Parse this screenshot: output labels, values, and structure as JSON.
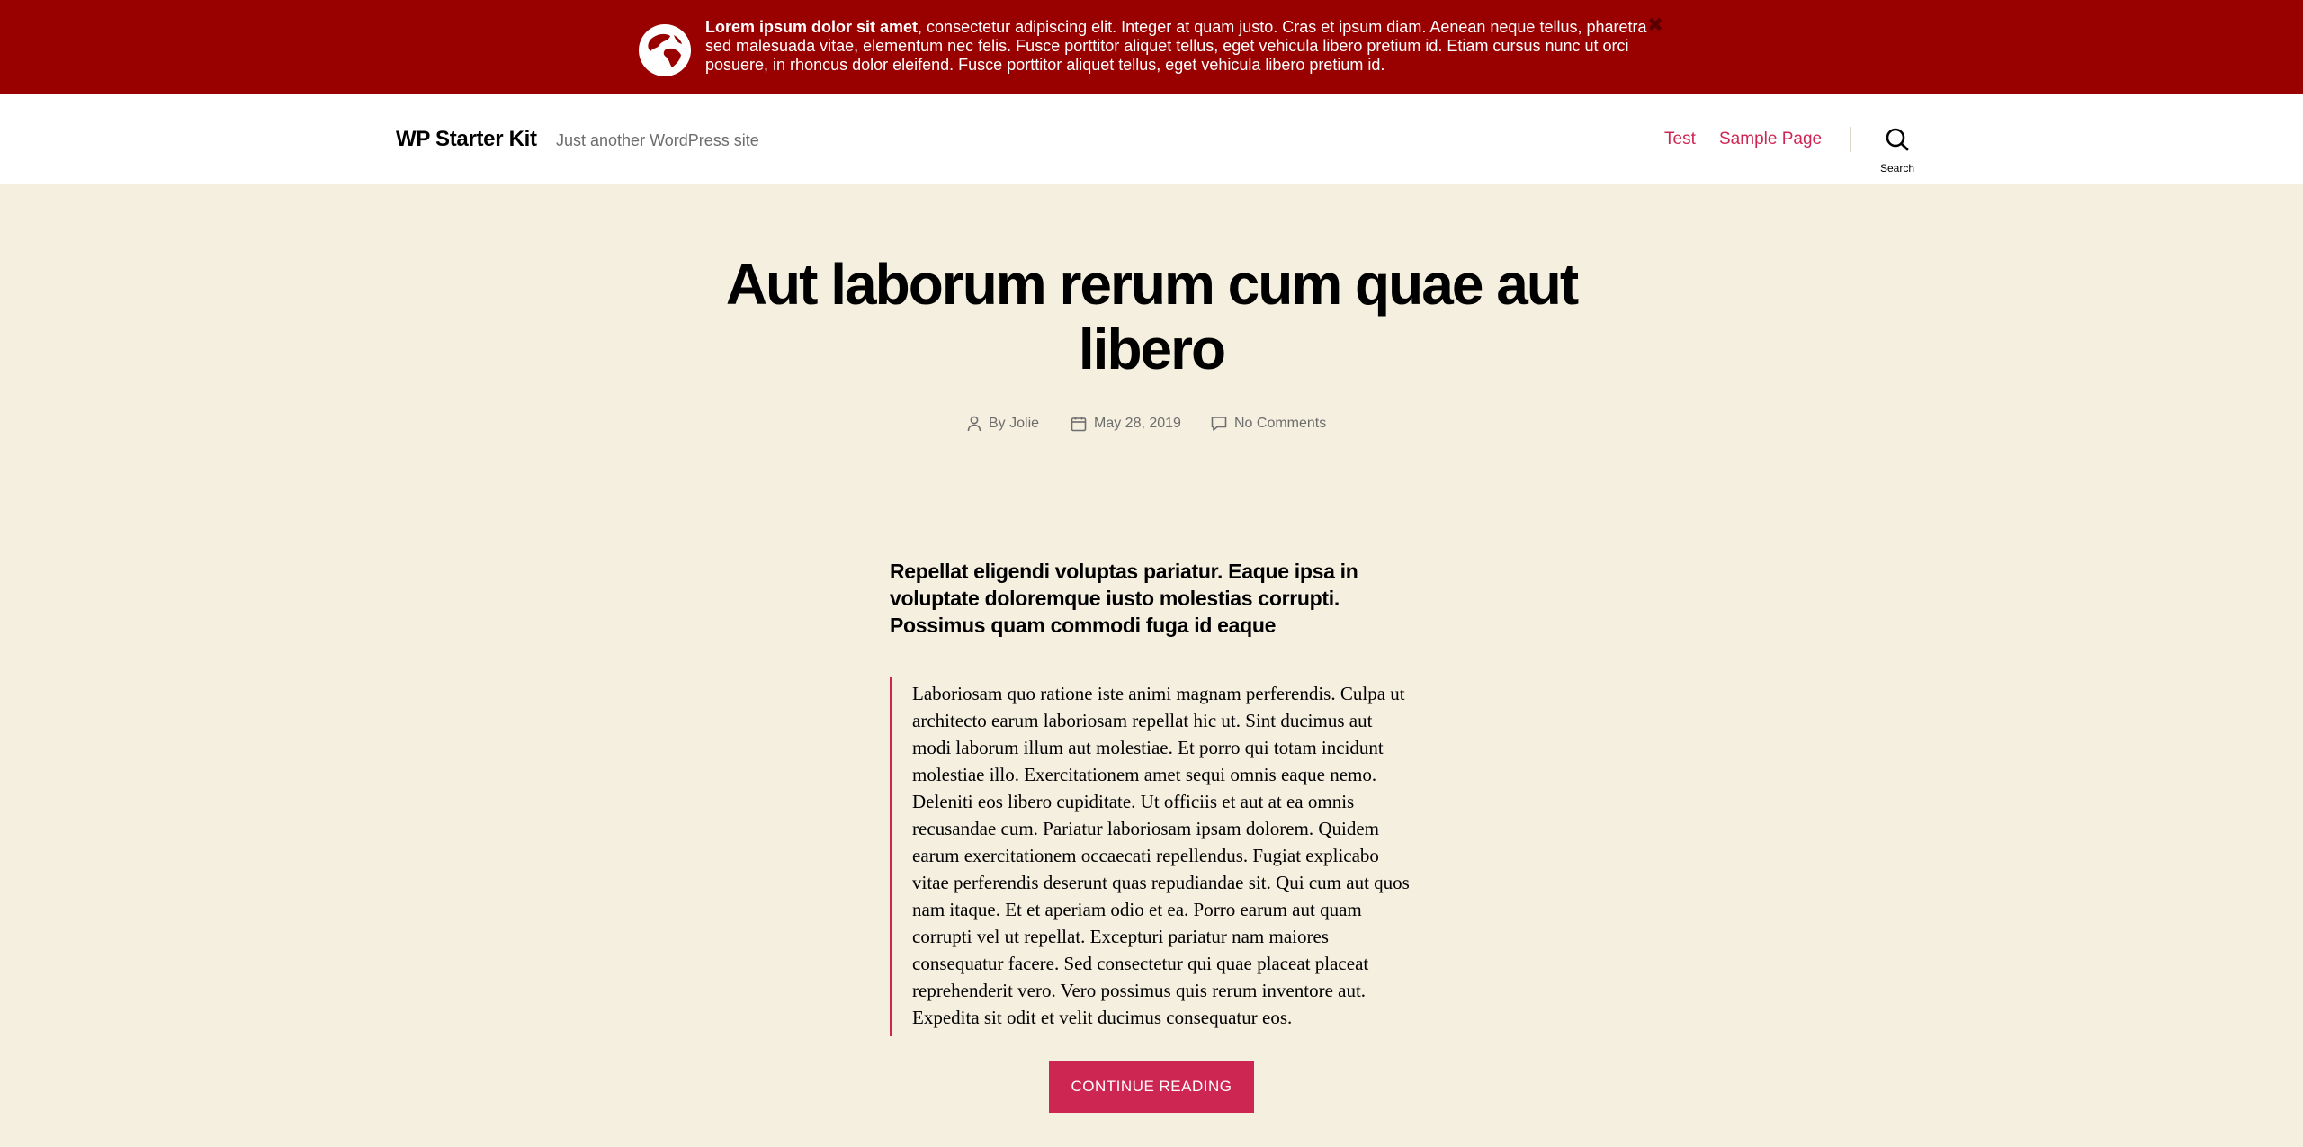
{
  "banner": {
    "bold_text": "Lorem ipsum dolor sit amet",
    "text": ", consectetur adipiscing elit. Integer at quam justo. Cras et ipsum diam. Aenean neque tellus, pharetra sed malesuada vitae, elementum nec felis. Fusce porttitor aliquet tellus, eget vehicula libero pretium id. Etiam cursus nunc ut orci posuere, in rhoncus dolor eleifend. Fusce porttitor aliquet tellus, eget vehicula libero pretium id.",
    "close_label": "✖",
    "background_color": "#990000",
    "icon": "globe-icon"
  },
  "header": {
    "site_title": "WP Starter Kit",
    "site_description": "Just another WordPress site",
    "nav": [
      {
        "label": "Test"
      },
      {
        "label": "Sample Page"
      }
    ],
    "search_label": "Search",
    "accent_color": "#cd2653"
  },
  "post": {
    "title": "Aut laborum rerum cum quae aut libero",
    "author_label": "By Jolie",
    "date": "May 28, 2019",
    "comments": "No Comments",
    "intro": "Repellat eligendi voluptas pariatur. Eaque ipsa in voluptate doloremque iusto molestias corrupti. Possimus quam commodi fuga id eaque",
    "quote": "Laboriosam quo ratione iste animi magnam perferendis. Culpa ut architecto earum laboriosam repellat hic ut. Sint ducimus aut modi laborum illum aut molestiae. Et porro qui totam incidunt molestiae illo. Exercitationem amet sequi omnis eaque nemo. Deleniti eos libero cupiditate. Ut officiis et aut at ea omnis recusandae cum. Pariatur laboriosam ipsam dolorem. Quidem earum exercitationem occaecati repellendus. Fugiat explicabo vitae perferendis deserunt quas repudiandae sit. Qui cum aut quos nam itaque. Et et aperiam odio et ea. Porro earum aut quam corrupti vel ut repellat. Excepturi pariatur nam maiores consequatur facere. Sed consectetur qui quae placeat placeat reprehenderit vero. Vero possimus quis rerum inventore aut. Expedita sit odit et velit ducimus consequatur eos.",
    "continue_label": "Continue reading",
    "background_color": "#f5efe0"
  }
}
